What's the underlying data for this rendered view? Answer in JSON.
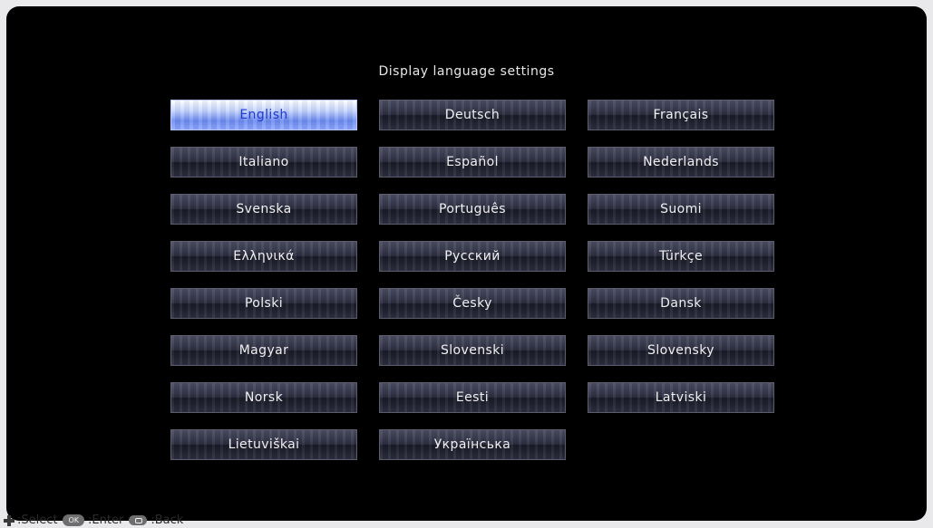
{
  "screen": {
    "title": "Display language settings"
  },
  "languages": [
    {
      "label": "English",
      "selected": true
    },
    {
      "label": "Deutsch",
      "selected": false
    },
    {
      "label": "Français",
      "selected": false
    },
    {
      "label": "Italiano",
      "selected": false
    },
    {
      "label": "Español",
      "selected": false
    },
    {
      "label": "Nederlands",
      "selected": false
    },
    {
      "label": "Svenska",
      "selected": false
    },
    {
      "label": "Português",
      "selected": false
    },
    {
      "label": "Suomi",
      "selected": false
    },
    {
      "label": "Ελληνικά",
      "selected": false
    },
    {
      "label": "Русский",
      "selected": false
    },
    {
      "label": "Türkçe",
      "selected": false
    },
    {
      "label": "Polski",
      "selected": false
    },
    {
      "label": "Česky",
      "selected": false
    },
    {
      "label": "Dansk",
      "selected": false
    },
    {
      "label": "Magyar",
      "selected": false
    },
    {
      "label": "Slovenski",
      "selected": false
    },
    {
      "label": "Slovensky",
      "selected": false
    },
    {
      "label": "Norsk",
      "selected": false
    },
    {
      "label": "Eesti",
      "selected": false
    },
    {
      "label": "Latviski",
      "selected": false
    },
    {
      "label": "Lietuviškai",
      "selected": false
    },
    {
      "label": "Українська",
      "selected": false
    }
  ],
  "footer": {
    "select_icon": "dpad-icon",
    "select_label": ":Select",
    "enter_button": "OK",
    "enter_label": ":Enter",
    "back_icon": "back-button-icon",
    "back_label": ":Back"
  },
  "colors": {
    "selected_text": "#1e3ad0",
    "selected_bg": "#8fa8ff",
    "button_bg": "#2e3043",
    "screen_bg": "#000000"
  }
}
